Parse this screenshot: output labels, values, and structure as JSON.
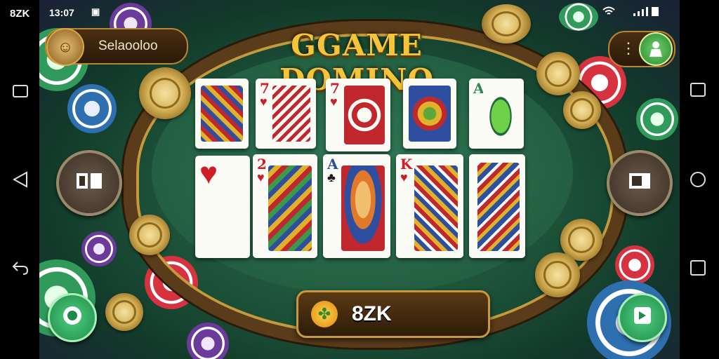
{
  "system": {
    "app_label": "8ZK",
    "clock": "13:07",
    "nav_left": [
      "square",
      "back-triangle",
      "return-arrow"
    ],
    "nav_right": [
      "square",
      "circle",
      "square"
    ]
  },
  "header": {
    "title": "GGAME DOMINO",
    "player_name": "Selaooloo"
  },
  "balance": {
    "value": "8ZK"
  },
  "colors": {
    "felt": "#245f42",
    "gold": "#c69a3c",
    "title": "#f4c43a",
    "accent_green": "#2f9a5a"
  },
  "cards": {
    "top": [
      {
        "rank": "",
        "suit": "",
        "color": "blk"
      },
      {
        "rank": "7",
        "suit": "♥",
        "color": "red"
      },
      {
        "rank": "7",
        "suit": "♥",
        "color": "red"
      },
      {
        "rank": "",
        "suit": "",
        "color": "blk"
      },
      {
        "rank": "A",
        "suit": "",
        "color": "blk"
      }
    ],
    "bottom": [
      {
        "rank": "",
        "suit": "♥",
        "color": "red"
      },
      {
        "rank": "2",
        "suit": "♥",
        "color": "red"
      },
      {
        "rank": "A",
        "suit": "♣",
        "color": "blk"
      },
      {
        "rank": "K",
        "suit": "♥",
        "color": "red"
      },
      {
        "rank": "",
        "suit": "",
        "color": "blk"
      }
    ]
  },
  "icons": {
    "menu": "more-dots-icon",
    "profile": "person-icon",
    "left_action": "book-icon",
    "right_action": "square-icon",
    "bottom_left": "chip-icon",
    "bottom_right": "share-icon",
    "balance": "coin-icon"
  }
}
